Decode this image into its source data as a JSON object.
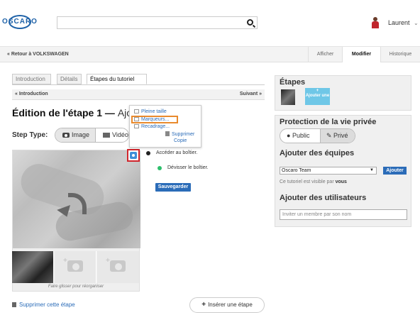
{
  "header": {
    "logo_text": "OSCARO",
    "search": {
      "value": "",
      "placeholder": ""
    },
    "user_name": "Laurent",
    "chevron": "⌄"
  },
  "subbar": {
    "back_link": "« Retour à VOLKSWAGEN",
    "tabs": [
      "Afficher",
      "Modifier",
      "Historique"
    ]
  },
  "tabs": [
    "Introduction",
    "Détails",
    "Étapes du tutoriel"
  ],
  "step_nav": {
    "prev": "« Introduction",
    "next": "Suivant »"
  },
  "edit_title": {
    "main": "Édition de l'étape 1 — ",
    "sub": "Ajou"
  },
  "step_type": {
    "label": "Step Type:",
    "options": [
      "Image",
      "Vidéo"
    ]
  },
  "popup_menu": {
    "items": [
      "Pleine taille",
      "Marqueurs...",
      "Recadrage...",
      "Supprimer",
      "Copie"
    ]
  },
  "bullets": [
    {
      "text": "Accéder au boîtier.",
      "color": "#222222"
    },
    {
      "text": "Dévisser le boîtier.",
      "color": "#2dbf6c"
    }
  ],
  "save_button": "Sauvegarder",
  "drag_hint": "Faire glisser pour réorganiser",
  "delete_step": "Supprimer cette étape",
  "insert_step": "Insérer une étape",
  "sidebar": {
    "steps_title": "Étapes",
    "add_tile": "Ajouter une",
    "add_tile_plus": "+",
    "privacy_title": "Protection de la vie privée",
    "privacy_options": [
      "Public",
      "Privé"
    ],
    "teams_title": "Ajouter des équipes",
    "team_select_value": "Oscaro Team",
    "add_team_button": "Ajouter",
    "team_note_prefix": "Ce tutoriel est visible par",
    "team_note_bold": "vous",
    "users_title": "Ajouter des utilisateurs",
    "invite_placeholder": "Inviter un membre par son nom"
  },
  "colors": {
    "accent": "#2b6cb8",
    "brand": "#1f62a8",
    "highlight_red": "#d0262d",
    "highlight_orange": "#e98a2d",
    "tile_blue": "#6fc7e7"
  }
}
